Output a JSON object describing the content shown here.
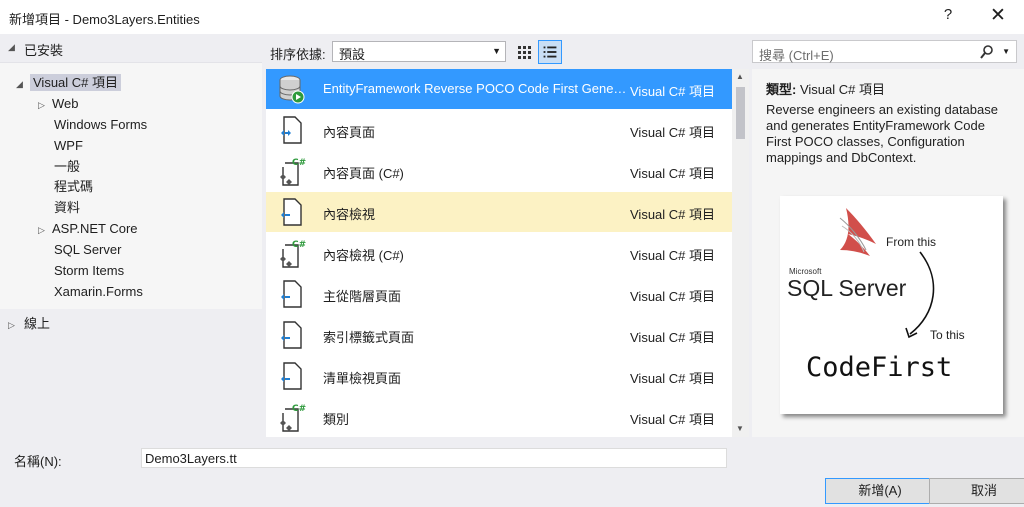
{
  "window": {
    "title": "新增項目 - Demo3Layers.Entities",
    "help": "?",
    "close": "✕"
  },
  "left": {
    "installed": "已安裝",
    "root": "Visual C# 項目",
    "items": [
      "Web",
      "Windows Forms",
      "WPF",
      "一般",
      "程式碼",
      "資料",
      "ASP.NET Core",
      "SQL Server",
      "Storm Items",
      "Xamarin.Forms"
    ],
    "online": "線上"
  },
  "sort": {
    "label": "排序依據:",
    "value": "預設"
  },
  "search": {
    "placeholder": "搜尋 (Ctrl+E)"
  },
  "list": {
    "items": [
      {
        "name": "EntityFramework Reverse POCO Code First Generator",
        "kind": "Visual C# 項目",
        "icon": "database-icon",
        "state": "selected"
      },
      {
        "name": "內容頁面",
        "kind": "Visual C# 項目",
        "icon": "page-icon",
        "state": ""
      },
      {
        "name": "內容頁面 (C#)",
        "kind": "Visual C# 項目",
        "icon": "csharp-page-icon",
        "state": ""
      },
      {
        "name": "內容檢視",
        "kind": "Visual C# 項目",
        "icon": "page-icon",
        "state": "hover"
      },
      {
        "name": "內容檢視 (C#)",
        "kind": "Visual C# 項目",
        "icon": "csharp-page-icon",
        "state": ""
      },
      {
        "name": "主從階層頁面",
        "kind": "Visual C# 項目",
        "icon": "page-icon",
        "state": ""
      },
      {
        "name": "索引標籤式頁面",
        "kind": "Visual C# 項目",
        "icon": "page-icon",
        "state": ""
      },
      {
        "name": "清單檢視頁面",
        "kind": "Visual C# 項目",
        "icon": "page-icon",
        "state": ""
      },
      {
        "name": "類別",
        "kind": "Visual C# 項目",
        "icon": "csharp-page-icon",
        "state": ""
      }
    ]
  },
  "details": {
    "type_label": "類型:",
    "type_value": "Visual C# 項目",
    "description": "Reverse engineers an existing database and generates EntityFramework Code First POCO classes, Configuration mappings and DbContext.",
    "preview": {
      "brand": "Microsoft",
      "sql_server": "SQL Server",
      "from_this": "From this",
      "to_this": "To this",
      "code_first": "CodeFirst"
    }
  },
  "bottom": {
    "name_label": "名稱(N):",
    "name_value": "Demo3Layers.tt",
    "ok": "新增(A)",
    "cancel": "取消"
  },
  "colors": {
    "selection": "#3399ff",
    "hover": "#fcf2c4",
    "dialog_bg": "#eeeef2"
  }
}
